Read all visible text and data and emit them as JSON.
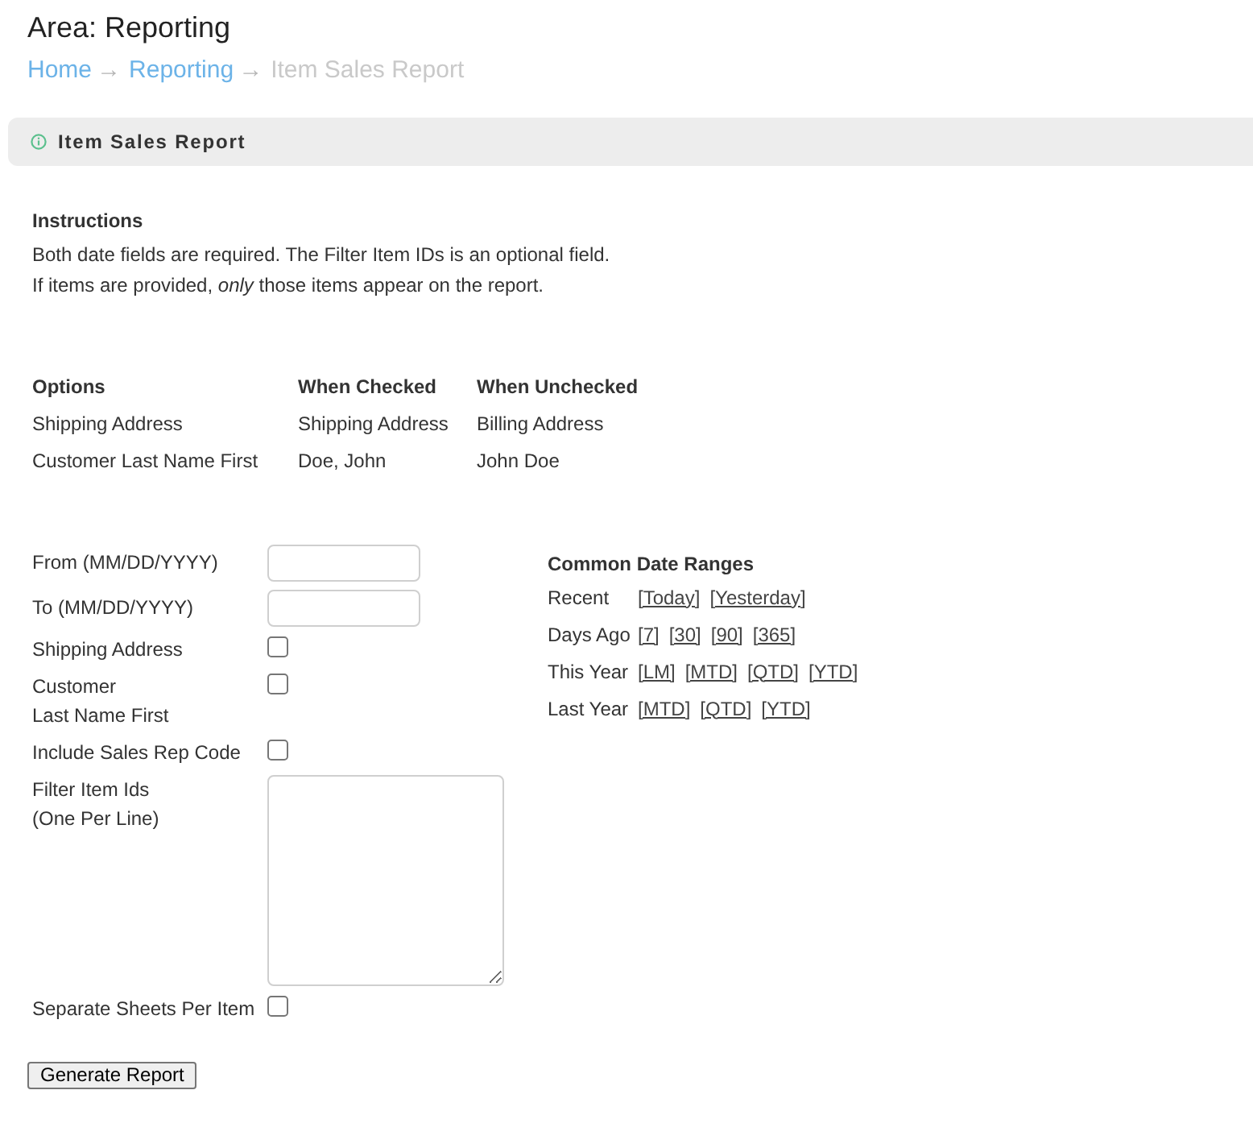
{
  "page": {
    "title": "Area: Reporting"
  },
  "breadcrumb": {
    "items": [
      {
        "label": "Home",
        "current": false,
        "separator": "→"
      },
      {
        "label": "Reporting",
        "current": false,
        "separator": "→"
      },
      {
        "label": "Item Sales Report",
        "current": true
      }
    ]
  },
  "panel": {
    "title": "Item Sales Report"
  },
  "instructions": {
    "heading": "Instructions",
    "lines": [
      "Both date fields are required. The Filter Item IDs is an optional field.",
      "If items are provided, *only* those items appear on the report."
    ]
  },
  "options_table": {
    "columns": [
      "Options",
      "When Checked",
      "When Unchecked"
    ],
    "rows": [
      [
        "Shipping Address",
        "Shipping Address",
        "Billing Address"
      ],
      [
        "Customer Last Name First",
        "Doe, John",
        "John Doe"
      ]
    ]
  },
  "form": {
    "fields": [
      {
        "kind": "text",
        "label": [
          "From (MM/DD/YYYY)"
        ]
      },
      {
        "kind": "text",
        "label": [
          "To (MM/DD/YYYY)"
        ]
      },
      {
        "kind": "checkbox",
        "label": [
          "Shipping Address"
        ],
        "checked": false
      },
      {
        "kind": "checkbox",
        "label": [
          "Customer",
          "Last Name First"
        ],
        "checked": false
      },
      {
        "kind": "checkbox",
        "label": [
          "Include Sales Rep Code"
        ],
        "checked": false
      },
      {
        "kind": "textarea",
        "label": [
          "Filter Item Ids",
          "(One Per Line)"
        ]
      },
      {
        "kind": "checkbox",
        "label": [
          "Separate Sheets Per Item"
        ],
        "checked": false
      }
    ],
    "submit": "Generate Report"
  },
  "date_ranges": {
    "heading": "Common Date Ranges",
    "rows": [
      {
        "label": "Recent",
        "links": [
          "[Today]",
          "[Yesterday]"
        ]
      },
      {
        "label": "Days Ago",
        "links": [
          "[7]",
          "[30]",
          "[90]",
          "[365]"
        ]
      },
      {
        "label": "This Year",
        "links": [
          "[LM]",
          "[MTD]",
          "[QTD]",
          "[YTD]"
        ]
      },
      {
        "label": "Last Year",
        "links": [
          "[MTD]",
          "[QTD]",
          "[YTD]"
        ]
      }
    ]
  }
}
